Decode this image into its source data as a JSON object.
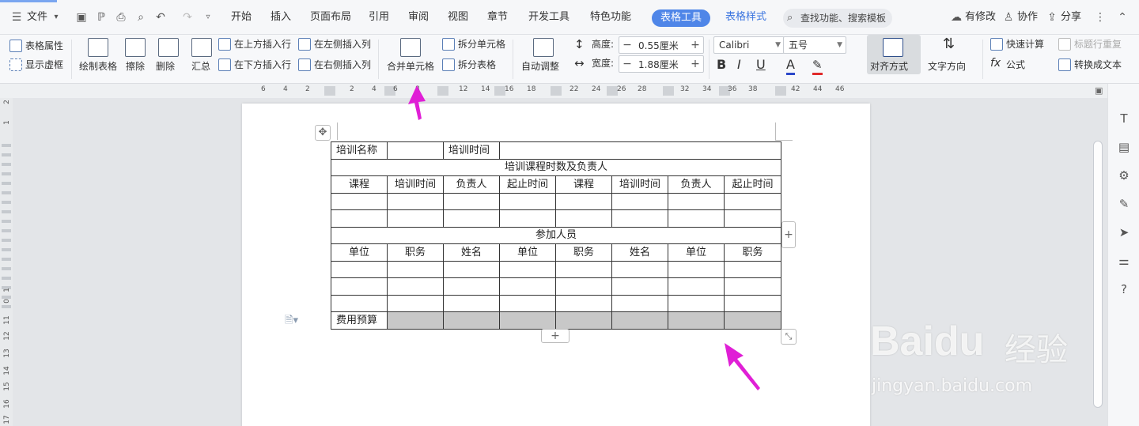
{
  "menu": {
    "file_label": "文件",
    "tabs": [
      "开始",
      "插入",
      "页面布局",
      "引用",
      "审阅",
      "视图",
      "章节",
      "开发工具",
      "特色功能"
    ],
    "active_tab": "表格工具",
    "style_tab": "表格样式",
    "search_placeholder": "查找功能、搜索模板",
    "right": {
      "modified": "有修改",
      "collab": "协作",
      "share": "分享"
    }
  },
  "ribbon": {
    "table_props": "表格属性",
    "show_grid": "显示虚框",
    "draw_table": "绘制表格",
    "erase": "擦除",
    "delete": "删除",
    "summary": "汇总",
    "insert_above": "在上方插入行",
    "insert_below": "在下方插入行",
    "insert_left": "在左侧插入列",
    "insert_right": "在右侧插入列",
    "merge_cells": "合并单元格",
    "split_cells": "拆分单元格",
    "split_table": "拆分表格",
    "auto_fit": "自动调整",
    "height_label": "高度:",
    "height_value": "0.55厘米",
    "width_label": "宽度:",
    "width_value": "1.88厘米",
    "font_name": "Calibri",
    "font_size": "五号",
    "align": "对齐方式",
    "text_dir": "文字方向",
    "quick_calc": "快速计算",
    "header_repeat": "标题行重复",
    "formula": "公式",
    "to_text": "转换成文本"
  },
  "ruler": {
    "ticks": [
      "6",
      "4",
      "2",
      "2",
      "4",
      "6",
      "8",
      "12",
      "14",
      "16",
      "18",
      "22",
      "24",
      "26",
      "28",
      "32",
      "34",
      "36",
      "38",
      "42",
      "44",
      "46"
    ],
    "vticks": [
      "2",
      "1",
      "1",
      "0",
      "11",
      "12",
      "13",
      "14",
      "15",
      "16",
      "17"
    ]
  },
  "table": {
    "r1": [
      "培训名称",
      "",
      "培训时间",
      ""
    ],
    "r2": "培训课程时数及负责人",
    "r3": [
      "课程",
      "培训时间",
      "负责人",
      "起止时间",
      "课程",
      "培训时间",
      "负责人",
      "起止时间"
    ],
    "r6": "参加人员",
    "r7": [
      "单位",
      "职务",
      "姓名",
      "单位",
      "职务",
      "姓名",
      "单位",
      "职务"
    ],
    "budget": "费用预算"
  },
  "watermark": {
    "brand": "Baidu",
    "cn": "经验",
    "url": "jingyan.baidu.com"
  },
  "colors": {
    "accent": "#4f86e8",
    "arrow": "#e01fd6",
    "shade": "#c8c8c8"
  }
}
